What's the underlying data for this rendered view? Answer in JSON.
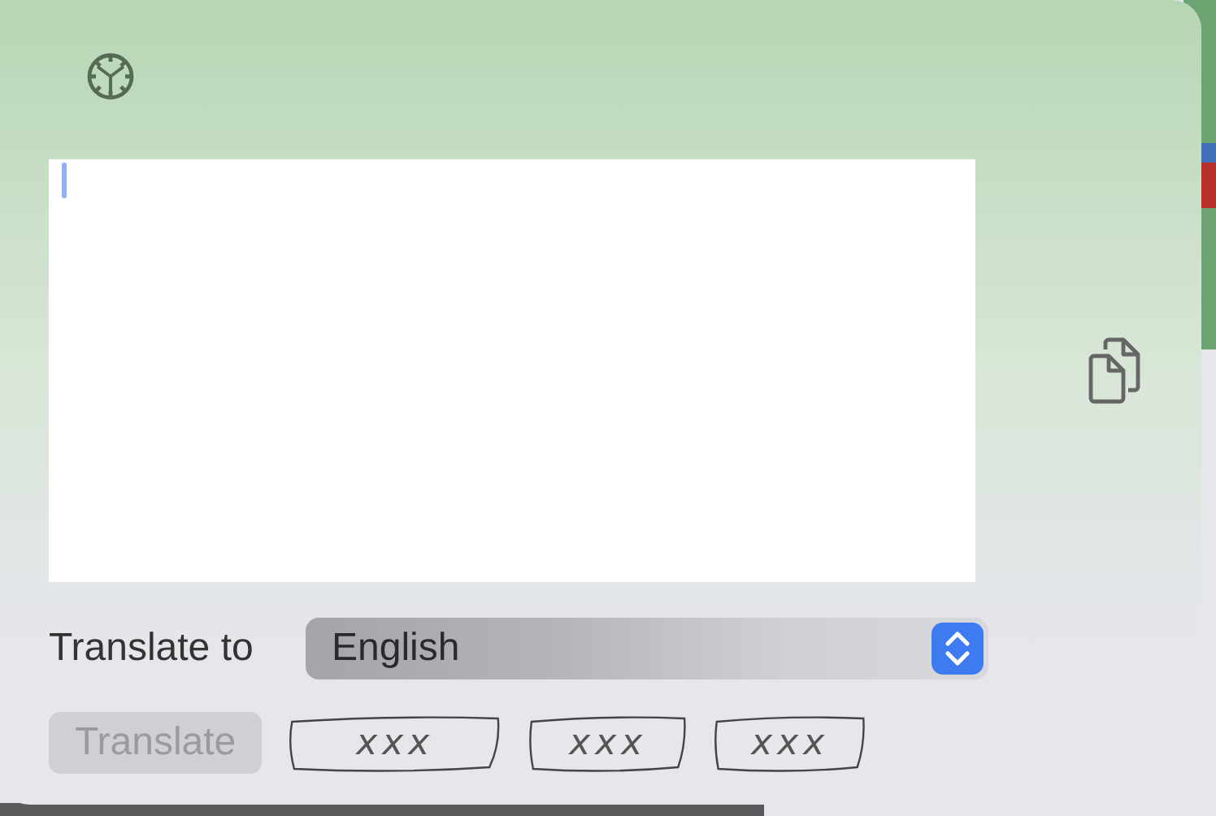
{
  "translate_to": {
    "label": "Translate to",
    "value": "English"
  },
  "translate_button": {
    "label": "Translate",
    "disabled": true
  },
  "sketch_buttons": [
    {
      "label": "xxx"
    },
    {
      "label": "xxx"
    },
    {
      "label": "xxx"
    }
  ]
}
